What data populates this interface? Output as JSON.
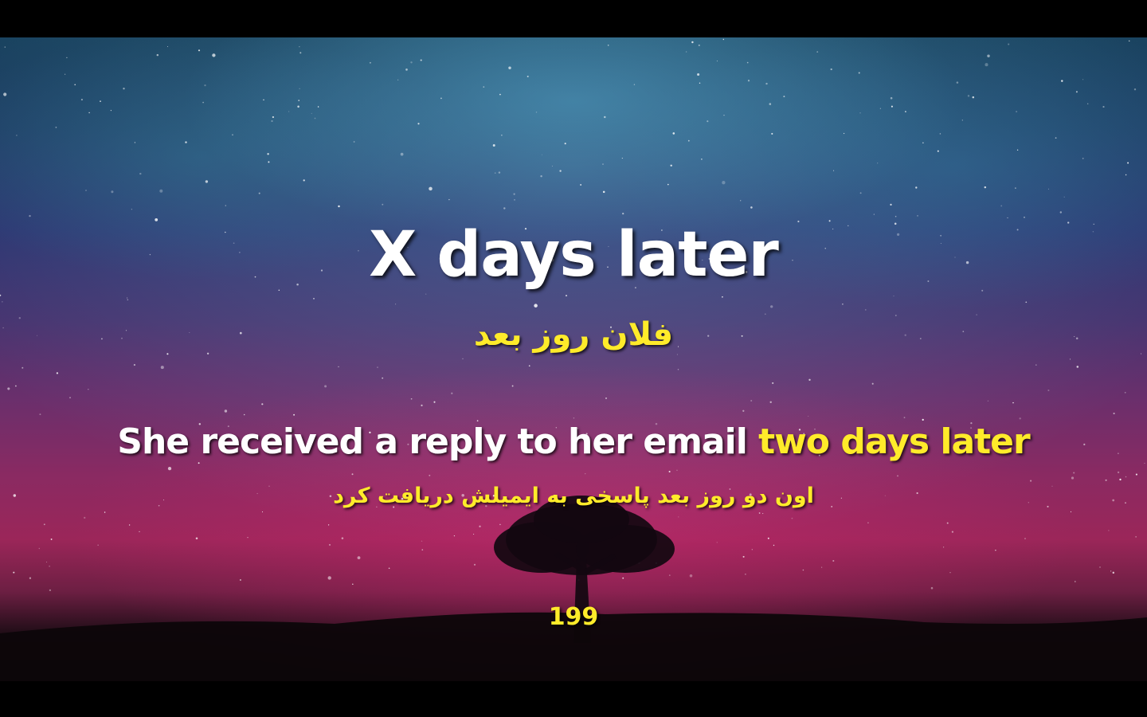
{
  "slide": {
    "title": "X days later",
    "title_translation": "فلان روز بعد",
    "example_main": "She received a reply to her email ",
    "example_highlight": "two days later",
    "example_translation": "اون دو روز بعد پاسخی به ایمیلش دریافت کرد",
    "page_number": "199"
  },
  "colors": {
    "primary_text": "#ffffff",
    "highlight_text": "#ffeb2a",
    "letterbox": "#000000"
  }
}
